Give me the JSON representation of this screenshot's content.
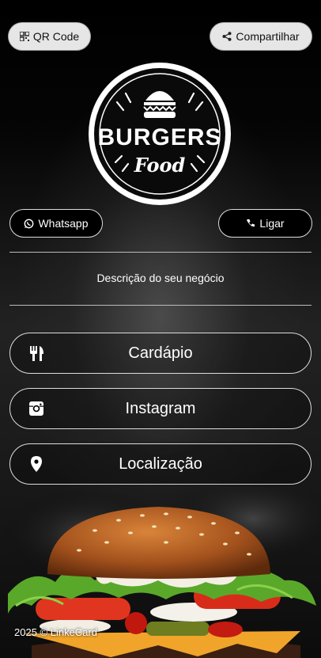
{
  "top_bar": {
    "qr_label": "QR Code",
    "share_label": "Compartilhar"
  },
  "logo": {
    "line1": "BURGERS",
    "line2": "Food"
  },
  "contact": {
    "whatsapp_label": "Whatsapp",
    "call_label": "Ligar"
  },
  "description": "Descrição do seu negócio",
  "links": [
    {
      "label": "Cardápio",
      "icon": "utensils-icon"
    },
    {
      "label": "Instagram",
      "icon": "instagram-icon"
    },
    {
      "label": "Localização",
      "icon": "map-pin-icon"
    }
  ],
  "footer": "2025 © LinkeCard"
}
